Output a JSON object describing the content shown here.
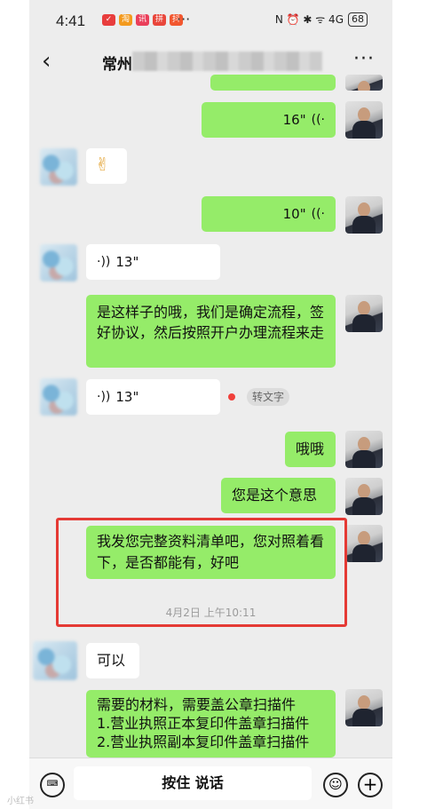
{
  "status_bar": {
    "time": "4:41",
    "app_icons": [
      "✓",
      "淘",
      "讯",
      "拼",
      "抖"
    ],
    "more": "···",
    "status_icons": "N ⏰ ✱ ᯤ 4G",
    "battery": "68"
  },
  "header": {
    "back": "‹",
    "title": "常州",
    "more": "···"
  },
  "messages": {
    "m1_duration": "16\"",
    "m2_emoji": "✌",
    "m3_duration": "10\"",
    "m4_duration": "13\"",
    "m5_text": "是这样子的哦，我们是确定流程，签好协议，然后按照开户办理流程来走",
    "m6_duration": "13\"",
    "m6_transcribe": "转文字",
    "m7_text": "哦哦",
    "m8_text": "您是这个意思",
    "m9_text": "我发您完整资料清单吧，您对照着看下，是否都能有，好吧",
    "timestamp": "4月2日 上午10:11",
    "m10_text": "可以",
    "m11_text": "需要的材料，需要盖公章扫描件\n1.营业执照正本复印件盖章扫描件\n2.营业执照副本复印件盖章扫描件"
  },
  "bottom": {
    "keyboard_icon": "⌨",
    "hold_to_talk": "按住 说话",
    "emoji_icon": "☺",
    "plus_icon": "+"
  },
  "watermark": "小红书"
}
